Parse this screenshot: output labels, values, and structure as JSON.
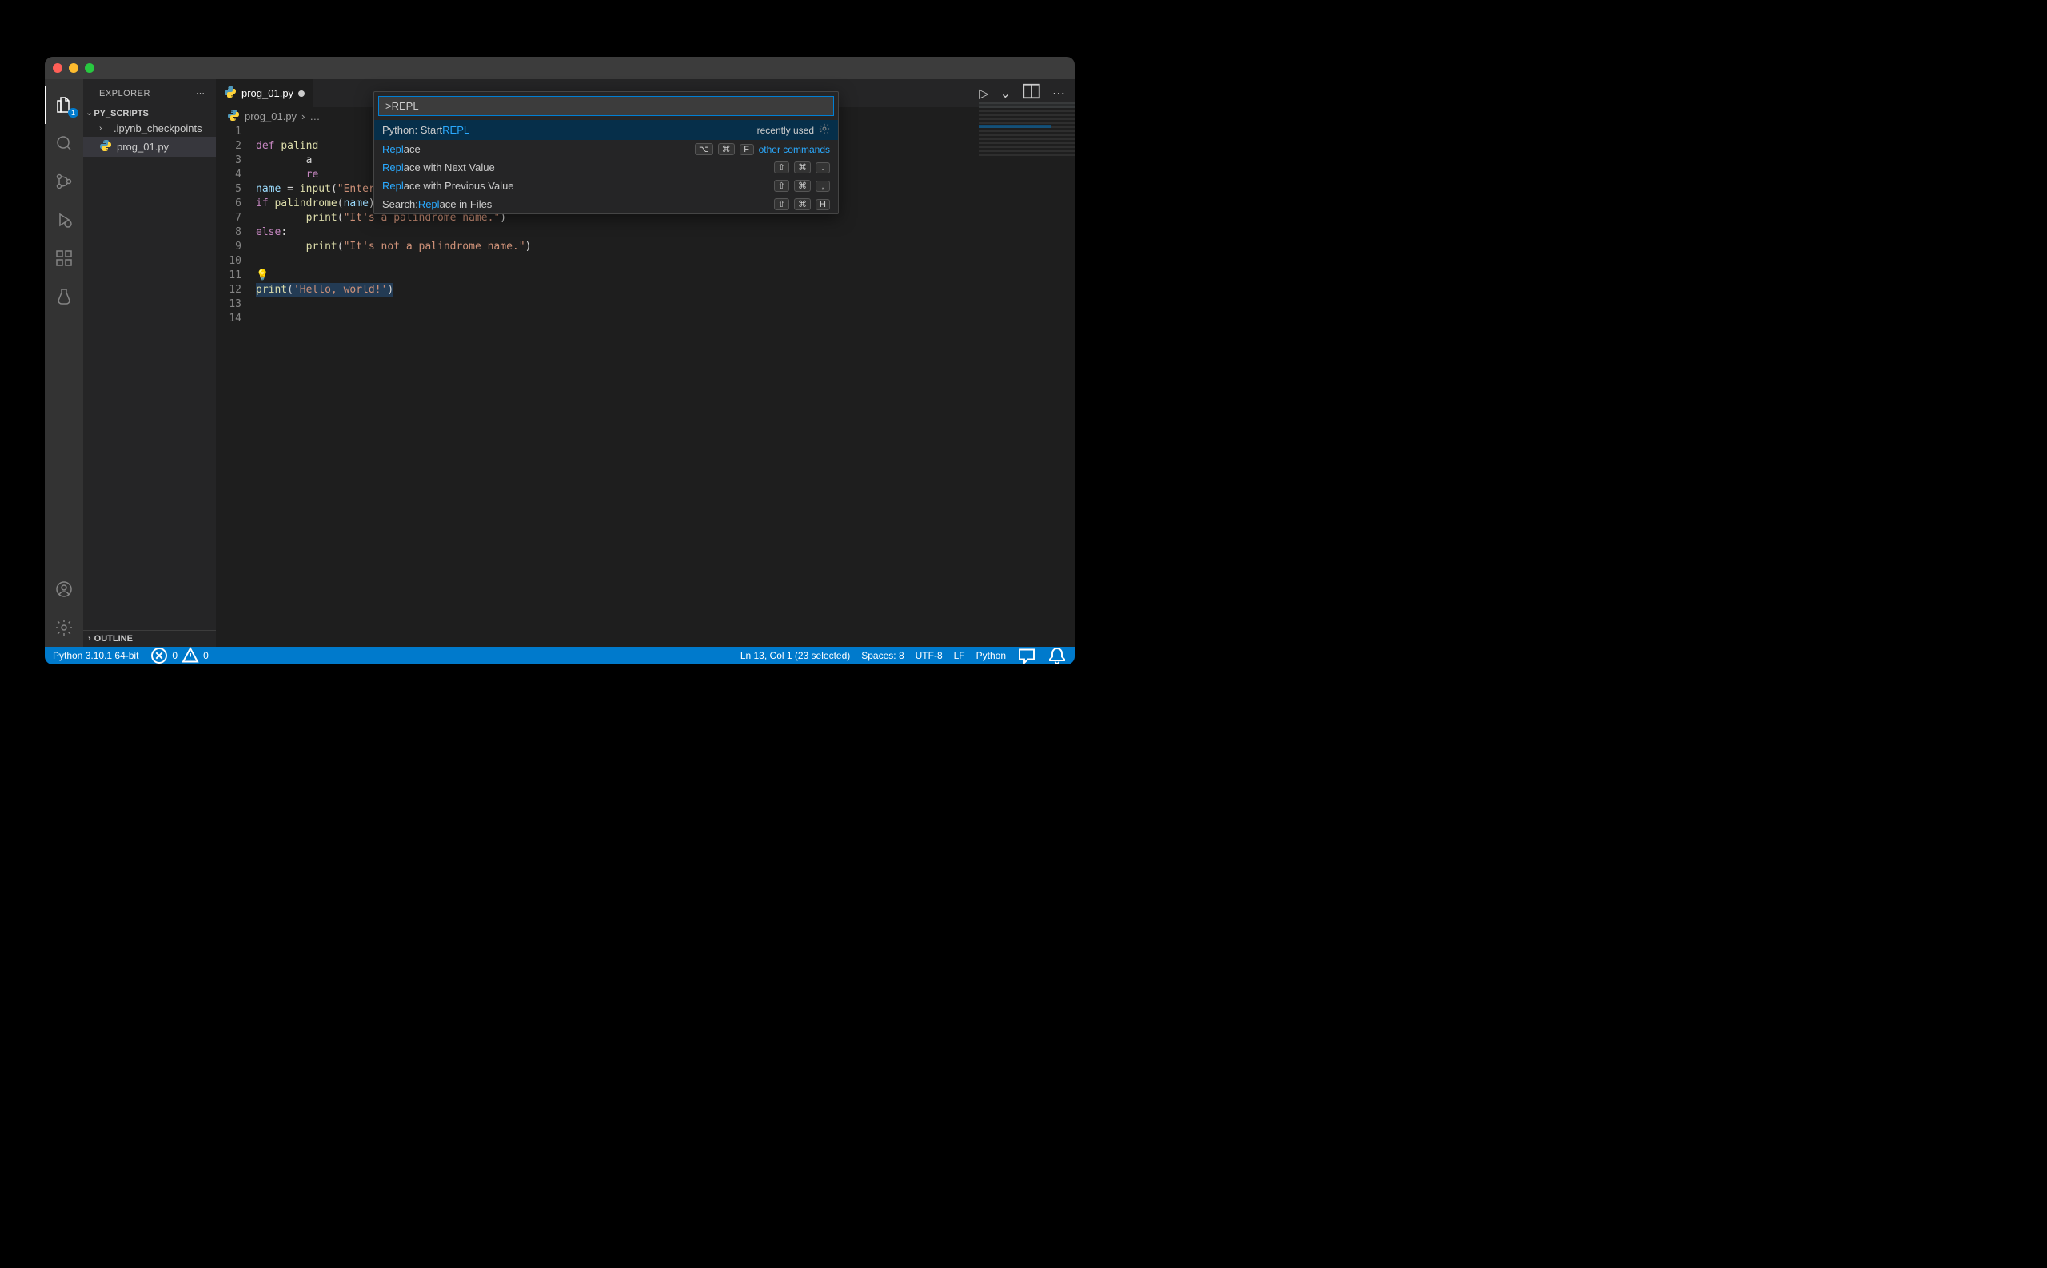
{
  "sidebar": {
    "title": "EXPLORER",
    "section": "PY_SCRIPTS",
    "items": [
      {
        "label": ".ipynb_checkpoints",
        "type": "folder"
      },
      {
        "label": "prog_01.py",
        "type": "file"
      }
    ],
    "outline": "OUTLINE"
  },
  "activity": {
    "explorer_badge": "1"
  },
  "tab": {
    "label": "prog_01.py"
  },
  "breadcrumb": {
    "file": "prog_01.py",
    "more": "…"
  },
  "tab_actions": {
    "run": "▷",
    "chev": "⌄",
    "split": "⧉",
    "more": "⋯"
  },
  "code": {
    "lines": [
      {
        "n": 1,
        "html": ""
      },
      {
        "n": 2,
        "html": "<span class='kw'>def</span> <span class='fn'>palind</span>"
      },
      {
        "n": 3,
        "html": "        a"
      },
      {
        "n": 4,
        "html": "        <span class='kw'>re</span>"
      },
      {
        "n": 5,
        "html": "<span class='var'>name</span> = <span class='fn'>input</span>(<span class='str'>\"Enter a name: \"</span>)"
      },
      {
        "n": 6,
        "html": "<span class='kw'>if</span> <span class='fn'>palindrome</span>(<span class='var'>name</span>):"
      },
      {
        "n": 7,
        "html": "        <span class='fn'>print</span>(<span class='str'>\"It's a palindrome name.\"</span>)"
      },
      {
        "n": 8,
        "html": "<span class='kw'>else</span>:"
      },
      {
        "n": 9,
        "html": "        <span class='fn'>print</span>(<span class='str'>\"It's not a palindrome name.\"</span>)"
      },
      {
        "n": 10,
        "html": ""
      },
      {
        "n": 11,
        "html": "<span class='bulb'>💡</span>"
      },
      {
        "n": 12,
        "html": "<span class='sel-line'><span class='fn'>print</span>(<span class='str'>'Hello, world!'</span>)</span>"
      },
      {
        "n": 13,
        "html": ""
      },
      {
        "n": 14,
        "html": ""
      }
    ]
  },
  "palette": {
    "input": ">REPL",
    "items": [
      {
        "pre": "Python: Start ",
        "hl": "REPL",
        "post": "",
        "meta": "recently used",
        "gear": true,
        "selected": true
      },
      {
        "pre": "",
        "hl": "Repl",
        "post": "ace",
        "keys": [
          "⌥",
          "⌘",
          "F"
        ],
        "meta": "other commands",
        "metalink": true
      },
      {
        "pre": "",
        "hl": "Repl",
        "post": "ace with Next Value",
        "keys": [
          "⇧",
          "⌘",
          "."
        ]
      },
      {
        "pre": "",
        "hl": "Repl",
        "post": "ace with Previous Value",
        "keys": [
          "⇧",
          "⌘",
          ","
        ]
      },
      {
        "pre": "Search: ",
        "hl": "Repl",
        "post": "ace in Files",
        "keys": [
          "⇧",
          "⌘",
          "H"
        ]
      }
    ]
  },
  "status": {
    "python": "Python 3.10.1 64-bit",
    "errors": "0",
    "warnings": "0",
    "selection": "Ln 13, Col 1 (23 selected)",
    "spaces": "Spaces: 8",
    "encoding": "UTF-8",
    "eol": "LF",
    "lang": "Python"
  }
}
